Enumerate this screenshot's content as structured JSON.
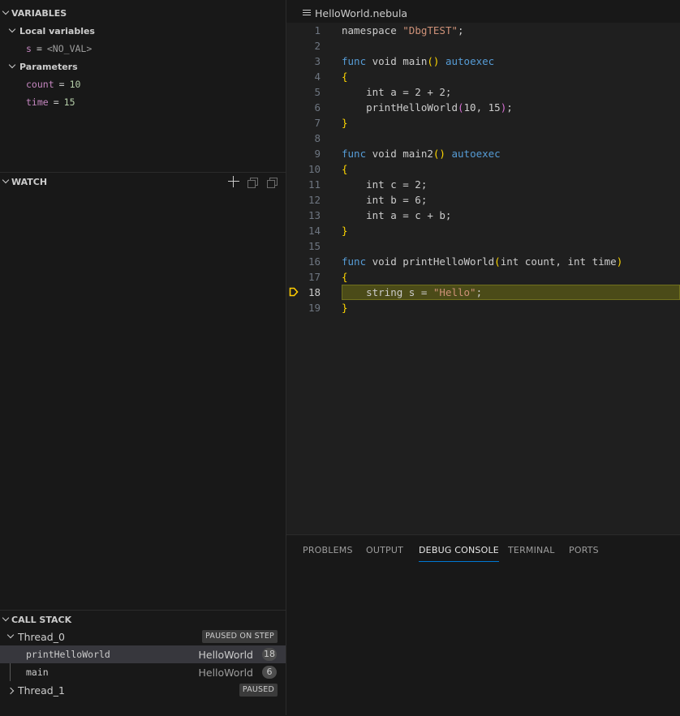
{
  "variables": {
    "title": "VARIABLES",
    "scopes": [
      {
        "label": "Local variables",
        "vars": [
          {
            "name": "s",
            "value": "<NO_VAL>"
          }
        ]
      },
      {
        "label": "Parameters",
        "vars": [
          {
            "name": "count",
            "value": "10"
          },
          {
            "name": "time",
            "value": "15"
          }
        ]
      }
    ]
  },
  "watch": {
    "title": "WATCH"
  },
  "call_stack": {
    "title": "CALL STACK",
    "threads": [
      {
        "label": "Thread_0",
        "state": "PAUSED ON STEP",
        "frames": [
          {
            "name": "printHelloWorld",
            "file": "HelloWorld",
            "line": "18"
          },
          {
            "name": "main",
            "file": "HelloWorld",
            "line": "6"
          }
        ]
      },
      {
        "label": "Thread_1",
        "state": "PAUSED"
      }
    ]
  },
  "editor": {
    "tab_label": "HelloWorld.nebula",
    "current_line": 18,
    "line_numbers": [
      "1",
      "2",
      "3",
      "4",
      "5",
      "6",
      "7",
      "8",
      "9",
      "10",
      "11",
      "12",
      "13",
      "14",
      "15",
      "16",
      "17",
      "18",
      "19"
    ]
  },
  "panel": {
    "tabs": [
      "PROBLEMS",
      "OUTPUT",
      "DEBUG CONSOLE",
      "TERMINAL",
      "PORTS"
    ],
    "active_tab": "DEBUG CONSOLE"
  },
  "colors": {
    "background": "#181818",
    "editor_background": "#1f1f1f",
    "current_line_highlight": "#4b4b18",
    "debug_pointer": "#ffcc00",
    "accent": "#0078d4"
  }
}
